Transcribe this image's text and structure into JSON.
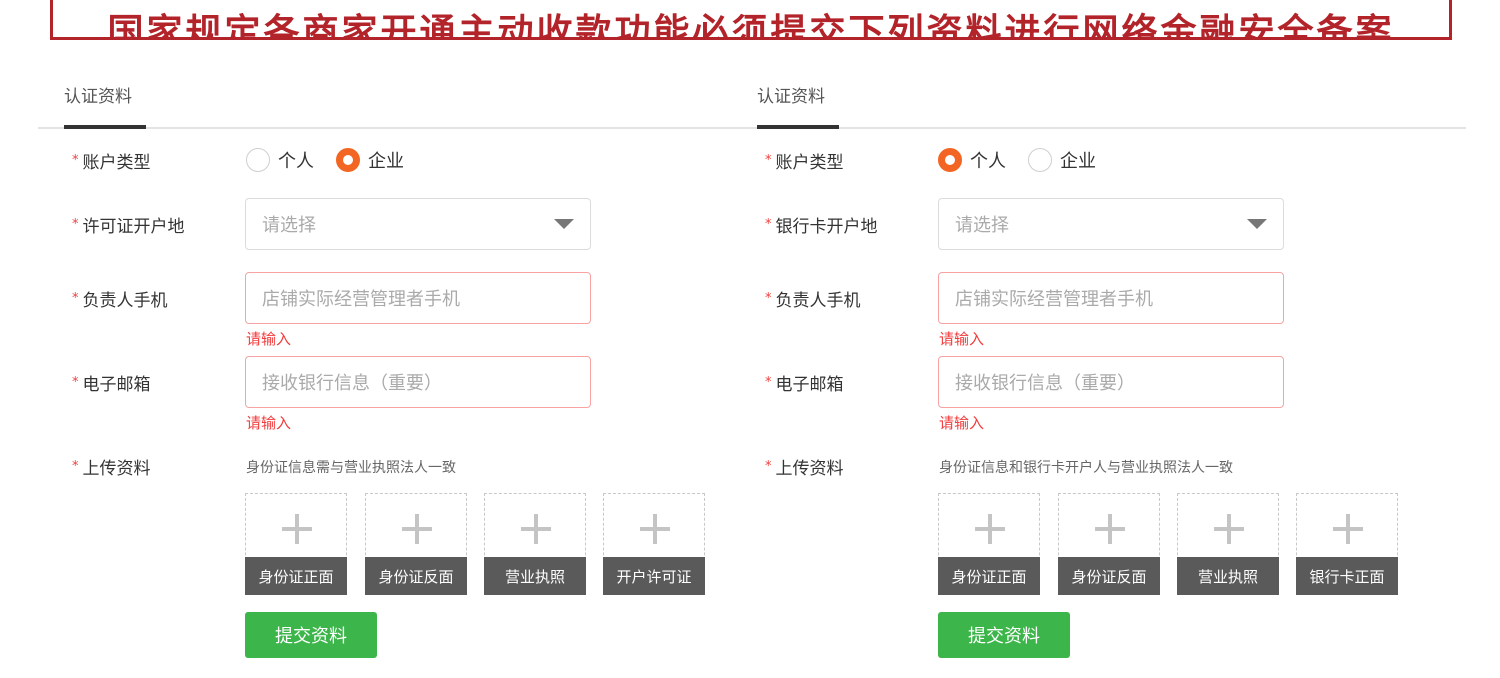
{
  "banner": {
    "text": "国家规定各商家开通主动收款功能必须提交下列资料进行网络金融安全备案"
  },
  "colors": {
    "banner": "#b3232a",
    "accent_radio": "#f26522",
    "submit": "#3cb54a",
    "error": "#f23c3c"
  },
  "forms": [
    {
      "tab": "认证资料",
      "account_type": {
        "label": "账户类型",
        "options": [
          "个人",
          "企业"
        ],
        "selected": "企业"
      },
      "location": {
        "label": "许可证开户地",
        "placeholder": "请选择"
      },
      "phone": {
        "label": "负责人手机",
        "placeholder": "店铺实际经营管理者手机",
        "error": "请输入"
      },
      "email": {
        "label": "电子邮箱",
        "placeholder": "接收银行信息（重要）",
        "error": "请输入"
      },
      "upload": {
        "label": "上传资料",
        "hint": "身份证信息需与营业执照法人一致",
        "items": [
          "身份证正面",
          "身份证反面",
          "营业执照",
          "开户许可证"
        ]
      },
      "submit_label": "提交资料"
    },
    {
      "tab": "认证资料",
      "account_type": {
        "label": "账户类型",
        "options": [
          "个人",
          "企业"
        ],
        "selected": "个人"
      },
      "location": {
        "label": "银行卡开户地",
        "placeholder": "请选择"
      },
      "phone": {
        "label": "负责人手机",
        "placeholder": "店铺实际经营管理者手机",
        "error": "请输入"
      },
      "email": {
        "label": "电子邮箱",
        "placeholder": "接收银行信息（重要）",
        "error": "请输入"
      },
      "upload": {
        "label": "上传资料",
        "hint": "身份证信息和银行卡开户人与营业执照法人一致",
        "items": [
          "身份证正面",
          "身份证反面",
          "营业执照",
          "银行卡正面"
        ]
      },
      "submit_label": "提交资料"
    }
  ]
}
